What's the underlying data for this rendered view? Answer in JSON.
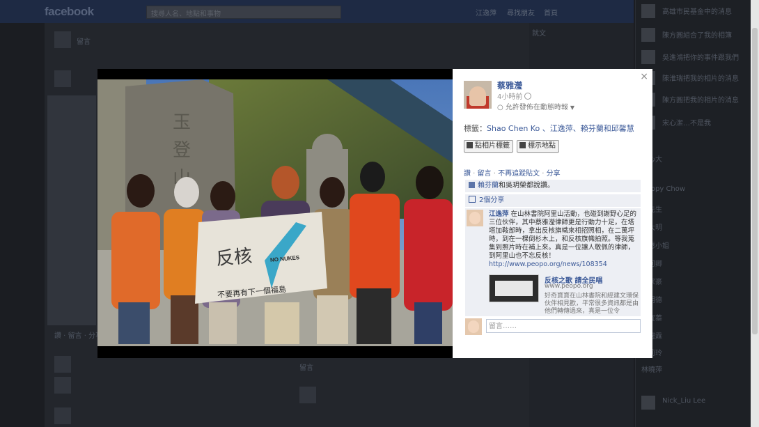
{
  "background": {
    "logo": "facebook",
    "search_placeholder": "搜尋人名、地點和事物",
    "top_nav": [
      "江逸萍",
      "尋找朋友",
      "首頁"
    ],
    "feed_snippets": [
      "留言",
      "留言",
      "讚 · 留言 · 分享",
      "就文"
    ],
    "right_list": [
      "高雄市民基金中的消息",
      "陳方圓組合了我的相簿",
      "吳進鴻把你的事件跟我們",
      "陳淮瑞把我的相片的消息",
      "陳方圓把我的相片的消息",
      "宋心潔…不是我",
      "安心大",
      "Happy Chow",
      "劉先生",
      "吳大明",
      "心愿小姐",
      "李阿卿",
      "吳家豪",
      "劉明德",
      "蔡宜蓁",
      "陳冠霖",
      "陳莉玲",
      "林曉萍",
      "Nick_Liu Lee"
    ]
  },
  "photo": {
    "banner_text": "反核",
    "banner_sub": "NO NUKES",
    "banner_line": "不要再有下一個福島"
  },
  "side": {
    "close_label": "×",
    "owner": "蔡雅瀅",
    "time": "4小時前",
    "audience": "允許發佈在動態時報",
    "tags_prefix": "標籤：",
    "tags_names": "Shao Chen Ko 、江逸萍、賴芬蘭和邱馨慧",
    "tag_photo_button": "點相片標籤",
    "tag_place_button": "標示地點",
    "actions": {
      "like": "讚",
      "comment": "留言",
      "unfollow": "不再追蹤貼文",
      "share": "分享"
    },
    "likes_text_names": "賴芬蘭",
    "likes_text_rest": "和吳玥榮都說讚。",
    "shares_text": "2個分享",
    "comment": {
      "author": "江逸萍",
      "text": "在山林書院阿里山活動，也碰到謝野心足的三位伙伴，其中蔡雅瀅律師更是行動力十足，在塔塔加鞍部時，拿出反核旗幟來相招照相，在二萬坪時，到在一棵倒杉木上，和反核旗幟拍照。等我蒐集到照片時在補上來。真是一位讓人敬佩的律師，到阿里山也不忘反核！",
      "link": "http://www.peopo.org/news/108354",
      "preview_title": "反核之歌 請全民唱",
      "preview_domain": "www.peopo.org",
      "preview_text": "好奇寶寶在山林書院和經建文環保伙伴相見歡，平常很多資訊都是由他們轉傳過來，真是一位令"
    },
    "comment_placeholder": "留言……"
  }
}
